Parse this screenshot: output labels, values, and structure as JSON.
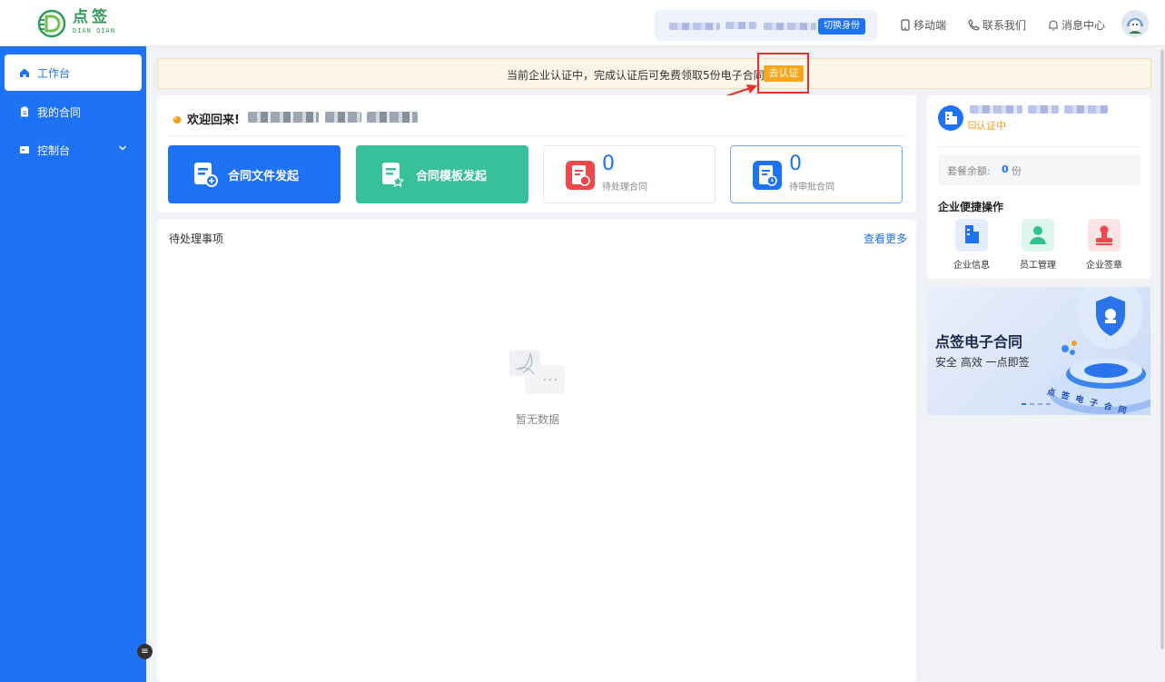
{
  "brand": {
    "name_cn": "点签",
    "name_en": "DIAN QIAN"
  },
  "header": {
    "switch_identity": "切换身份",
    "mobile": "移动端",
    "contact": "联系我们",
    "messages": "消息中心"
  },
  "sidebar": {
    "items": [
      {
        "label": "工作台",
        "icon": "home-icon",
        "active": true
      },
      {
        "label": "我的合同",
        "icon": "clipboard-icon",
        "active": false
      },
      {
        "label": "控制台",
        "icon": "console-icon",
        "active": false,
        "expandable": true
      }
    ]
  },
  "notice": {
    "text": "当前企业认证中，完成认证后可免费领取5份电子合同。",
    "action": "去认证"
  },
  "welcome": {
    "text": "欢迎回来!"
  },
  "actions": {
    "file_initiate": "合同文件发起",
    "template_initiate": "合同模板发起"
  },
  "stats": {
    "pending_count": "0",
    "pending_label": "待处理合同",
    "approval_count": "0",
    "approval_label": "待审批合同"
  },
  "todo": {
    "title": "待处理事项",
    "more": "查看更多",
    "empty": "暂无数据"
  },
  "company": {
    "cert_status": "认证中",
    "balance_label": "套餐余额:",
    "balance_value": "0",
    "balance_unit": "份",
    "quick_title": "企业便捷操作",
    "quick": [
      {
        "label": "企业信息",
        "icon": "building-icon",
        "color": "#1e72f5"
      },
      {
        "label": "员工管理",
        "icon": "user-icon",
        "color": "#2fc28f"
      },
      {
        "label": "企业签章",
        "icon": "seal-icon",
        "color": "#f0484a"
      }
    ]
  },
  "banner": {
    "title": "点签电子合同",
    "subtitle": "安全 高效 一点即签",
    "ring_text": "点 签 电 子 合 同"
  },
  "colors": {
    "primary": "#1e72f5",
    "green": "#38c09a",
    "warning": "#f7a81a",
    "highlight": "#e8302a"
  }
}
